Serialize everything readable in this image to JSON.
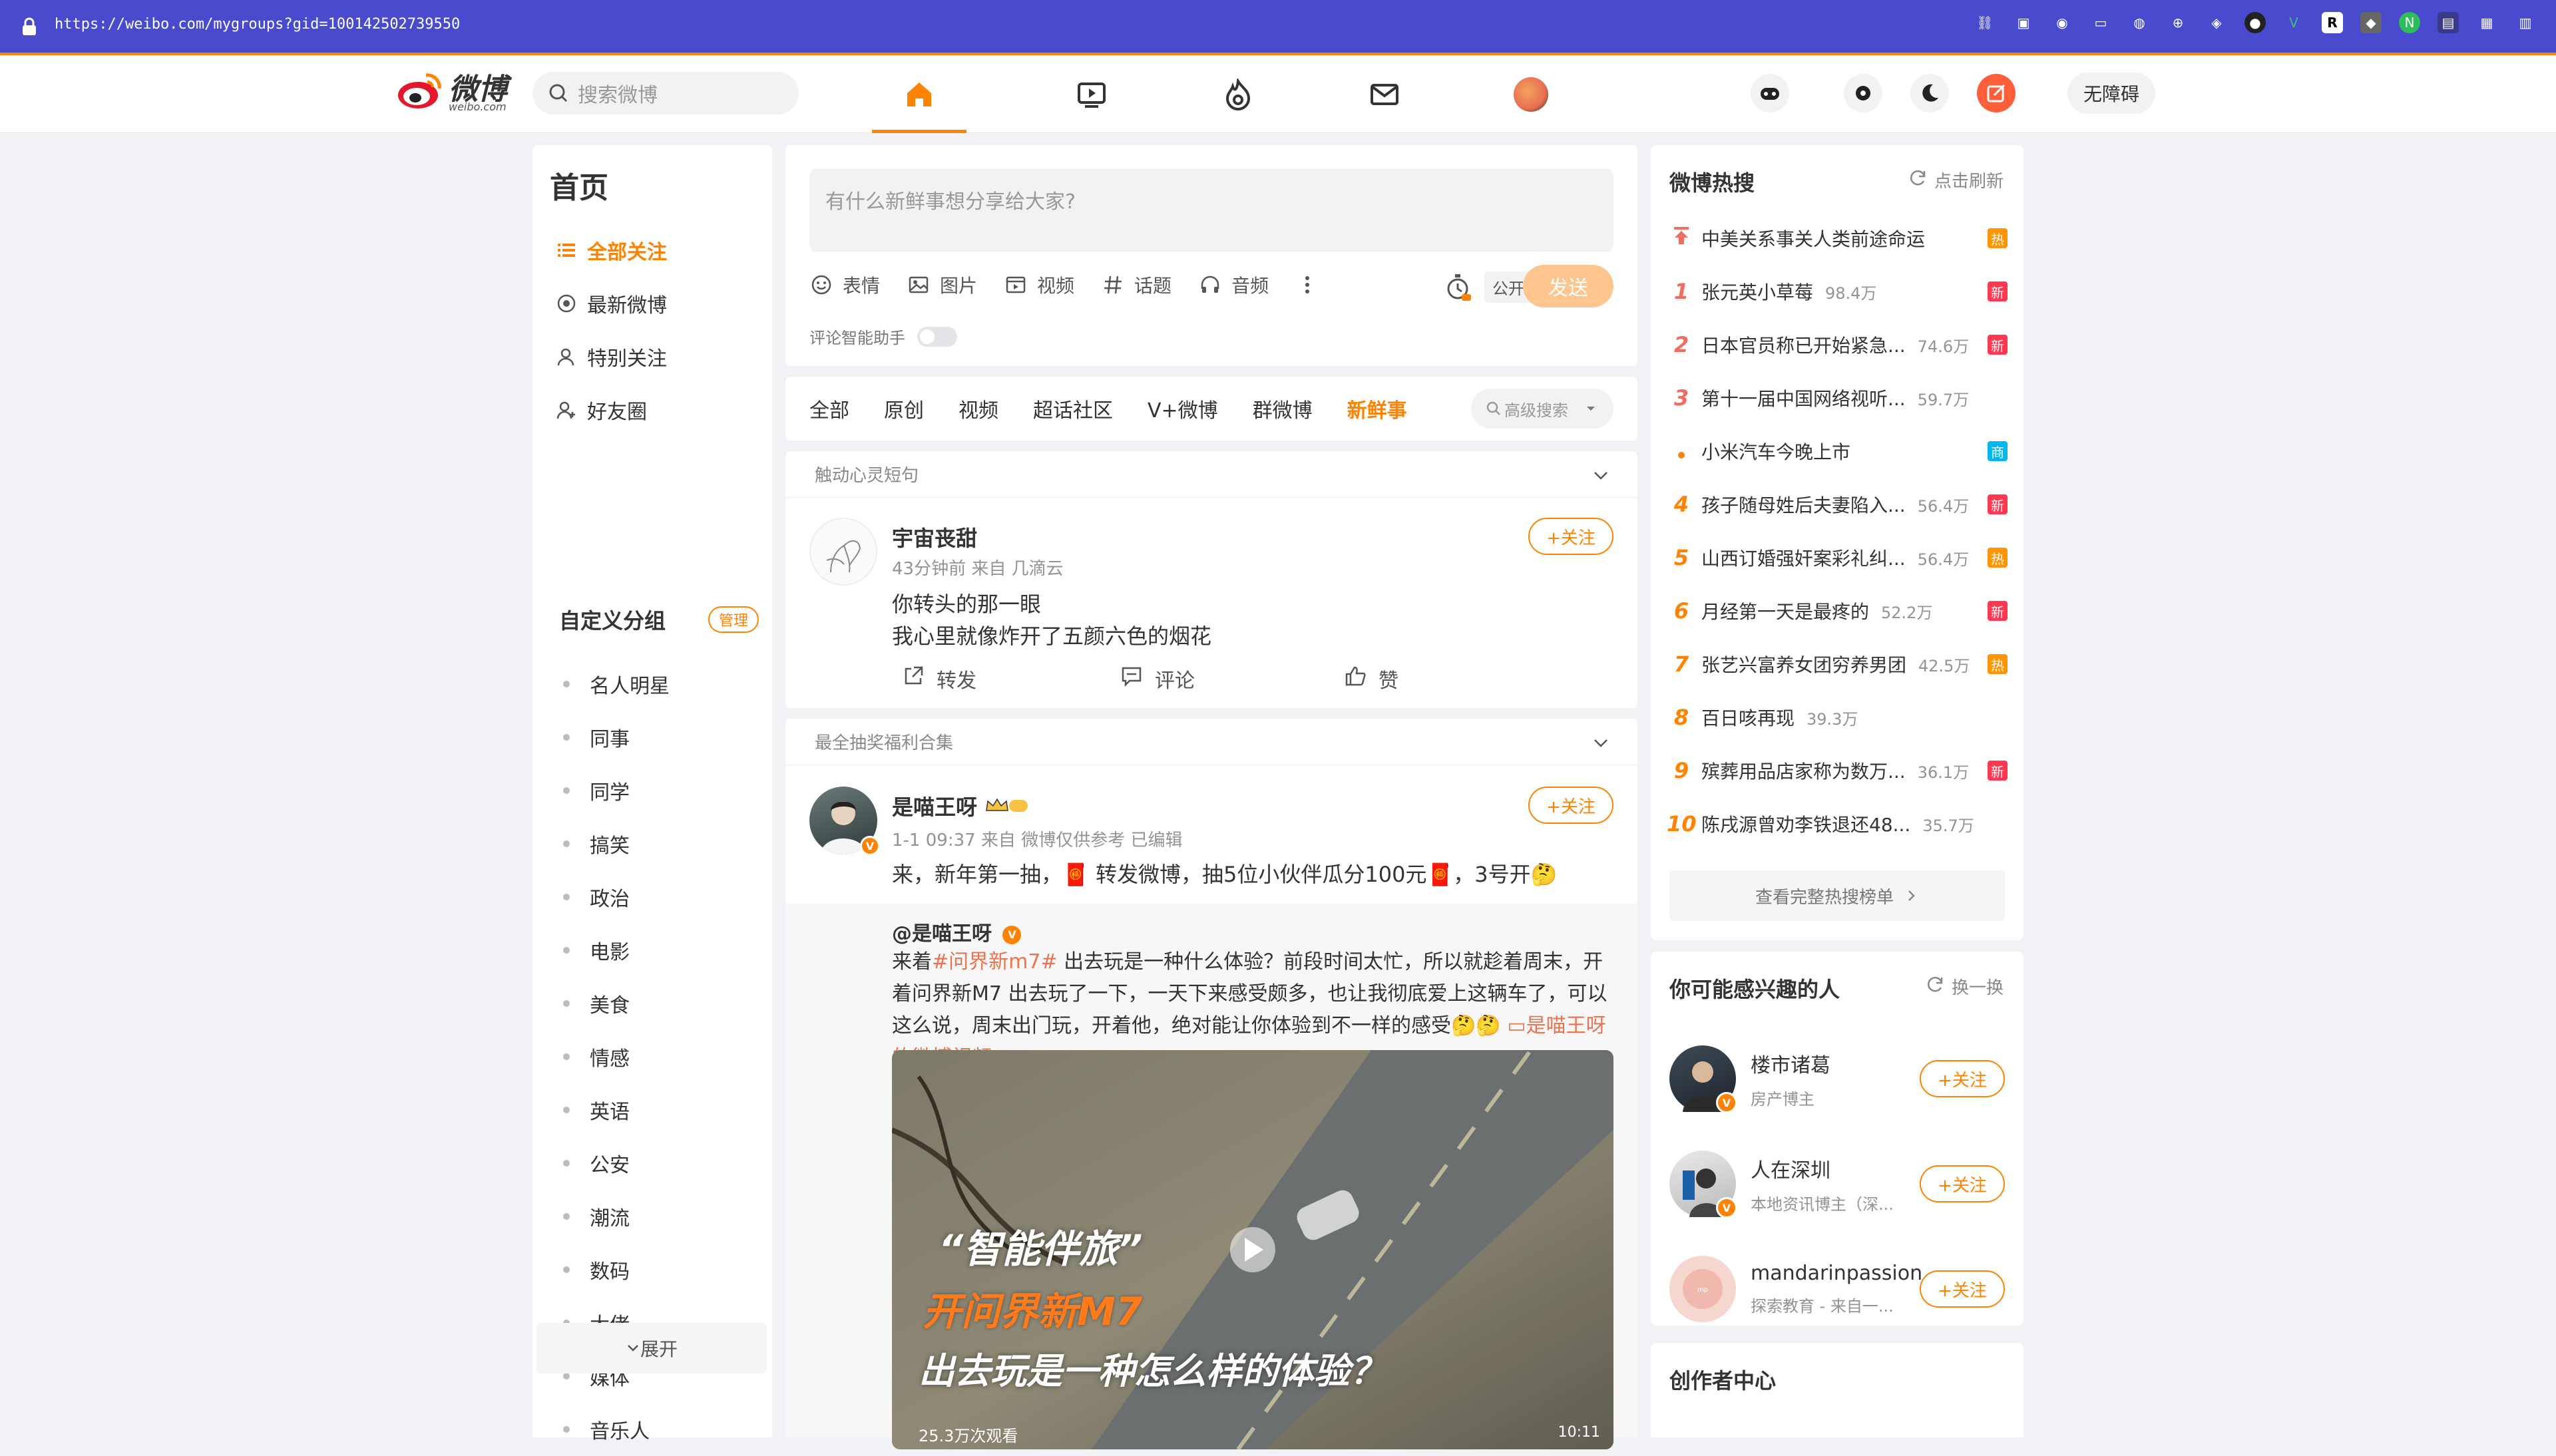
{
  "browser": {
    "url": "https://weibo.com/mygroups?gid=100142502739550"
  },
  "colors": {
    "accent": "#ff8200",
    "browser_bar": "#4a4acf",
    "hot_red": "#f26d5f",
    "badge_new": "#ff3852",
    "badge_hot": "#ff9406",
    "badge_shop": "#00b7ee"
  },
  "header": {
    "logo_text": "微博",
    "logo_sub": "weibo.com",
    "search_placeholder": "搜索微博",
    "accessibility_label": "无障碍",
    "nav": [
      "home-icon",
      "video-icon",
      "hot-icon",
      "mail-icon",
      "profile-avatar"
    ]
  },
  "left": {
    "title": "首页",
    "nav": [
      {
        "label": "全部关注",
        "icon": "list-icon"
      },
      {
        "label": "最新微博",
        "icon": "clock-icon"
      },
      {
        "label": "特别关注",
        "icon": "user-icon"
      },
      {
        "label": "好友圈",
        "icon": "users-icon"
      }
    ],
    "group_title": "自定义分组",
    "manage_label": "管理",
    "groups": [
      "名人明星",
      "同事",
      "同学",
      "搞笑",
      "政治",
      "电影",
      "美食",
      "情感",
      "英语",
      "公安",
      "潮流",
      "数码",
      "大佬",
      "媒体",
      "音乐人"
    ],
    "expand_label": "展开"
  },
  "composer": {
    "placeholder": "有什么新鲜事想分享给大家?",
    "tools": [
      "表情",
      "图片",
      "视频",
      "话题",
      "音频"
    ],
    "visibility": "公开",
    "send_label": "发送",
    "assist_label": "评论智能助手"
  },
  "tabs": {
    "items": [
      "全部",
      "原创",
      "视频",
      "超话社区",
      "V+微博",
      "群微博",
      "新鲜事"
    ],
    "active": "新鲜事",
    "advanced_search": "高级搜索"
  },
  "post1": {
    "source_header": "触动心灵短句",
    "user": "宇宙丧甜",
    "meta": "43分钟前  来自 几滴云",
    "follow_label": "+关注",
    "lines": [
      "你转头的那一眼",
      "我心里就像炸开了五颜六色的烟花"
    ],
    "actions": [
      "转发",
      "评论",
      "赞"
    ]
  },
  "post2": {
    "source_header": "最全抽奖福利合集",
    "user": "是喵王呀",
    "meta": "1-1 09:37  来自 微博仅供参考  已编辑",
    "follow_label": "+关注",
    "text": "来，新年第一抽，🧧 转发微博，抽5位小伙伴瓜分100元🧧，3号开🤔",
    "repost_user": "@是喵王呀",
    "repost_text_prefix": "来着",
    "repost_tag": "#问界新m7#",
    "repost_text_body": " 出去玩是一种什么体验？前段时间太忙，所以就趁着周末，开着问界新M7 出去玩了一下，一天下来感受颇多，也让我彻底爱上这辆车了，可以这么说，周末出门玩，开着他，绝对能让你体验到不一样的感受🤔🤔 ",
    "repost_link": "是喵王呀的微博视频",
    "video_title1": "“智能伴旅”",
    "video_title2": "开问界新M7",
    "video_title3": "出去玩是一种怎么样的体验？",
    "video_views": "25.3万次观看",
    "video_duration": "10:11"
  },
  "hot": {
    "title": "微博热搜",
    "refresh_label": "点击刷新",
    "items": [
      {
        "rank": "",
        "title": "中美关系事关人类前途命运",
        "count": "",
        "badge": "热",
        "badge_color": "#ff9406",
        "top": true
      },
      {
        "rank": "1",
        "title": "张元英小草莓",
        "count": "98.4万",
        "badge": "新",
        "badge_color": "#ff3852"
      },
      {
        "rank": "2",
        "title": "日本官员称已开始紧急...",
        "count": "74.6万",
        "badge": "新",
        "badge_color": "#ff3852"
      },
      {
        "rank": "3",
        "title": "第十一届中国网络视听...",
        "count": "59.7万",
        "badge": "",
        "badge_color": ""
      },
      {
        "rank": "•",
        "title": "小米汽车今晚上市",
        "count": "",
        "badge": "商",
        "badge_color": "#00b7ee"
      },
      {
        "rank": "4",
        "title": "孩子随母姓后夫妻陷入...",
        "count": "56.4万",
        "badge": "新",
        "badge_color": "#ff3852"
      },
      {
        "rank": "5",
        "title": "山西订婚强奸案彩礼纠...",
        "count": "56.4万",
        "badge": "热",
        "badge_color": "#ff9406"
      },
      {
        "rank": "6",
        "title": "月经第一天是最疼的",
        "count": "52.2万",
        "badge": "新",
        "badge_color": "#ff3852"
      },
      {
        "rank": "7",
        "title": "张艺兴富养女团穷养男团",
        "count": "42.5万",
        "badge": "热",
        "badge_color": "#ff9406"
      },
      {
        "rank": "8",
        "title": "百日咳再现",
        "count": "39.3万",
        "badge": "",
        "badge_color": ""
      },
      {
        "rank": "9",
        "title": "殡葬用品店家称为数万...",
        "count": "36.1万",
        "badge": "新",
        "badge_color": "#ff3852"
      },
      {
        "rank": "10",
        "title": "陈戌源曾劝李铁退还48...",
        "count": "35.7万",
        "badge": "",
        "badge_color": ""
      }
    ],
    "more_label": "查看完整热搜榜单"
  },
  "recommend": {
    "title": "你可能感兴趣的人",
    "refresh_label": "换一换",
    "items": [
      {
        "name": "楼市诸葛",
        "desc": "房产博主",
        "follow": "+关注"
      },
      {
        "name": "人在深圳",
        "desc": "本地资讯博主（深...",
        "follow": "+关注"
      },
      {
        "name": "mandarinpassion",
        "desc": "探索教育 - 来自一...",
        "follow": "+关注"
      }
    ]
  },
  "creator": {
    "title": "创作者中心"
  }
}
